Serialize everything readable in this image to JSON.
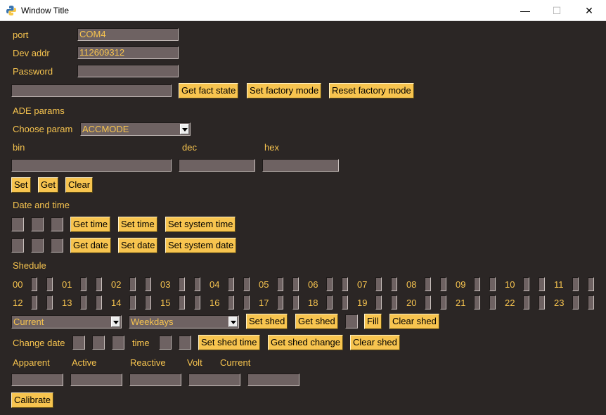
{
  "window": {
    "title": "Window Title",
    "minimize": "—",
    "maximize": "☐",
    "close": "✕"
  },
  "conn": {
    "port_label": "port",
    "port_value": "COM4",
    "dev_label": "Dev addr",
    "dev_value": "112609312",
    "pass_label": "Password",
    "pass_value": "",
    "fact_value": "",
    "get_fact_state": "Get fact state",
    "set_factory_mode": "Set factory mode",
    "reset_factory_mode": "Reset factory mode"
  },
  "ade": {
    "section": "ADE params",
    "choose_label": "Choose param",
    "choose_value": "ACCMODE",
    "bin_label": "bin",
    "dec_label": "dec",
    "hex_label": "hex",
    "set": "Set",
    "get": "Get",
    "clear": "Clear"
  },
  "datetime": {
    "section": "Date and time",
    "get_time": "Get time",
    "set_time": "Set time",
    "set_system_time": "Set system time",
    "get_date": "Get date",
    "set_date": "Set date",
    "set_system_date": "Set system date"
  },
  "schedule": {
    "section": "Shedule",
    "hours_row1": [
      "00",
      "01",
      "02",
      "03",
      "04",
      "05",
      "06",
      "07",
      "08",
      "09",
      "10",
      "11"
    ],
    "hours_row2": [
      "12",
      "13",
      "14",
      "15",
      "16",
      "17",
      "18",
      "19",
      "20",
      "21",
      "22",
      "23"
    ],
    "tariff_value": "Current",
    "daytype_value": "Weekdays",
    "set_shed": "Set shed",
    "get_shed": "Get shed",
    "fill": "Fill",
    "clear_shed": "Clear shed",
    "change_date_label": "Change date",
    "time_label": "time",
    "set_shed_time": "Set shed time",
    "get_shed_change": "Get shed change",
    "clear_shed2": "Clear shed"
  },
  "calib": {
    "apparent": "Apparent",
    "active": "Active",
    "reactive": "Reactive",
    "volt": "Volt",
    "current": "Current",
    "calibrate": "Calibrate"
  }
}
